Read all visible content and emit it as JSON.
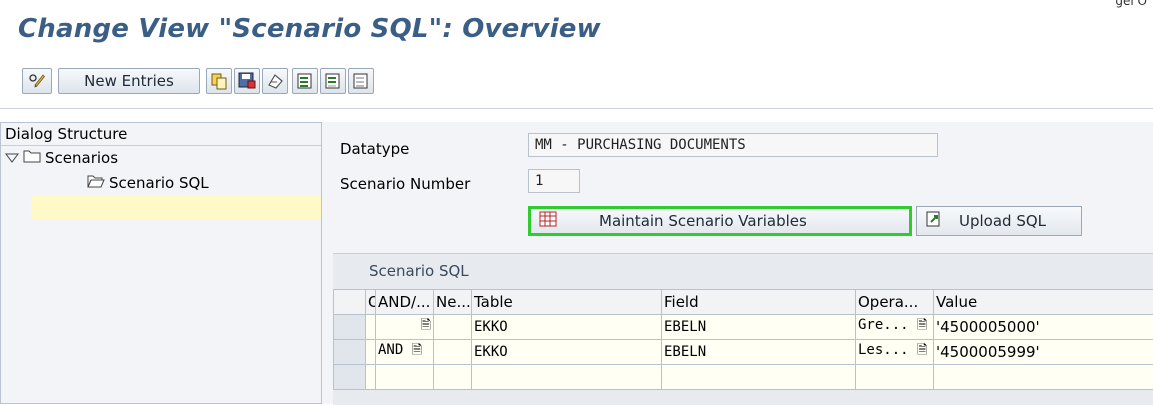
{
  "page": {
    "title": "Change View \"Scenario SQL\": Overview",
    "top_fragment": "gel O"
  },
  "toolbar": {
    "new_entries_label": "New Entries",
    "icons": [
      "edit-pencil-icon",
      "copy-icon",
      "save-copy-icon",
      "undo-icon",
      "select-all-icon",
      "select-block-icon",
      "deselect-all-icon"
    ]
  },
  "dialog": {
    "header": "Dialog Structure",
    "tree": [
      {
        "label": "Scenarios",
        "level": 0,
        "icon": "folder-icon",
        "expanded": true
      },
      {
        "label": "Scenario SQL",
        "level": 1,
        "icon": "open-folder-icon",
        "selected": true
      }
    ]
  },
  "form": {
    "datatype_label": "Datatype",
    "datatype_value": "MM - PURCHASING DOCUMENTS",
    "scenario_number_label": "Scenario Number",
    "scenario_number_value": "1"
  },
  "actions": {
    "maintain_vars_label": "Maintain Scenario Variables",
    "upload_sql_label": "Upload SQL"
  },
  "grid": {
    "title": "Scenario SQL",
    "columns": [
      "O",
      "AND/...",
      "Ne...",
      "Table",
      "Field",
      "Opera...",
      "Value"
    ],
    "rows": [
      {
        "and_or": "",
        "table": "EKKO",
        "field": "EBELN",
        "operator": "Gre...",
        "value": "'4500005000'"
      },
      {
        "and_or": "AND",
        "table": "EKKO",
        "field": "EBELN",
        "operator": "Les...",
        "value": "'4500005999'"
      }
    ]
  },
  "colors": {
    "title": "#3b5e86",
    "highlight_border": "#2ecc2e",
    "selection": "#fff8c7"
  }
}
